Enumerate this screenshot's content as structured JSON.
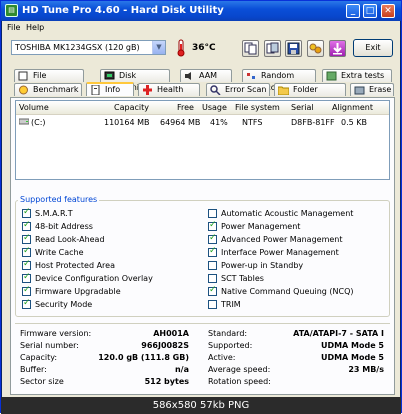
{
  "window": {
    "title": "HD Tune Pro 4.60 - Hard Disk Utility",
    "app_icon": "hd-tune-icon"
  },
  "menu": {
    "file": "File",
    "help": "Help"
  },
  "toolbar": {
    "drive": "TOSHIBA MK1234GSX (120 gB)",
    "temperature": "36°C",
    "exit_label": "Exit"
  },
  "tabs_top": [
    "File Benchmark",
    "Disk monitor",
    "AAM",
    "Random Access",
    "Extra tests"
  ],
  "tabs_bottom": [
    "Benchmark",
    "Info",
    "Health",
    "Error Scan",
    "Folder Usage",
    "Erase"
  ],
  "volumes": {
    "headers": [
      "Volume",
      "Capacity",
      "Free",
      "Usage",
      "File system",
      "Serial",
      "Alignment"
    ],
    "rows": [
      [
        "(C:)",
        "110164 MB",
        "64964 MB",
        "41%",
        "NTFS",
        "D8FB-81FF",
        "0.5 KB"
      ]
    ]
  },
  "features": {
    "title": "Supported features",
    "left": [
      {
        "label": "S.M.A.R.T",
        "checked": true
      },
      {
        "label": "48-bit Address",
        "checked": true
      },
      {
        "label": "Read Look-Ahead",
        "checked": true
      },
      {
        "label": "Write Cache",
        "checked": true
      },
      {
        "label": "Host Protected Area",
        "checked": true
      },
      {
        "label": "Device Configuration Overlay",
        "checked": true
      },
      {
        "label": "Firmware Upgradable",
        "checked": true
      },
      {
        "label": "Security Mode",
        "checked": true
      }
    ],
    "right": [
      {
        "label": "Automatic Acoustic Management",
        "checked": false
      },
      {
        "label": "Power Management",
        "checked": true
      },
      {
        "label": "Advanced Power Management",
        "checked": true
      },
      {
        "label": "Interface Power Management",
        "checked": true
      },
      {
        "label": "Power-up in Standby",
        "checked": false
      },
      {
        "label": "SCT Tables",
        "checked": false
      },
      {
        "label": "Native Command Queuing (NCQ)",
        "checked": true
      },
      {
        "label": "TRIM",
        "checked": false
      }
    ]
  },
  "details": {
    "left": [
      {
        "label": "Firmware version:",
        "value": "AH001A"
      },
      {
        "label": "Serial number:",
        "value": "966J0082S"
      },
      {
        "label": "Capacity:",
        "value": "120.0 gB (111.8 GB)"
      },
      {
        "label": "Buffer:",
        "value": "n/a"
      },
      {
        "label": "Sector size",
        "value": "512 bytes"
      }
    ],
    "right": [
      {
        "label": "Standard:",
        "value": "ATA/ATAPI-7 - SATA I"
      },
      {
        "label": "Supported:",
        "value": "UDMA Mode 5"
      },
      {
        "label": "Active:",
        "value": "UDMA Mode 5"
      },
      {
        "label": "Average speed:",
        "value": "23 MB/s"
      },
      {
        "label": "Rotation speed:",
        "value": ""
      }
    ]
  },
  "status": "586x580 57kb PNG"
}
